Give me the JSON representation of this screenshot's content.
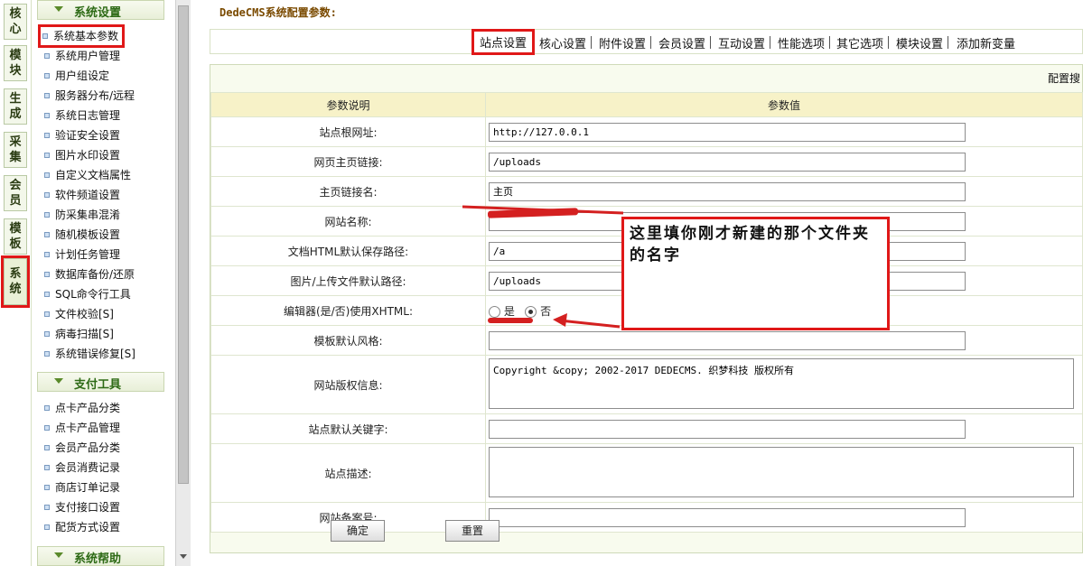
{
  "vtabs": [
    {
      "label": "核心"
    },
    {
      "label": "模块"
    },
    {
      "label": "生成"
    },
    {
      "label": "采集"
    },
    {
      "label": "会员"
    },
    {
      "label": "模板"
    },
    {
      "label": "系统"
    }
  ],
  "menu": {
    "sections": [
      {
        "title": "系统设置",
        "items": [
          "系统基本参数",
          "系统用户管理",
          "用户组设定",
          "服务器分布/远程",
          "系统日志管理",
          "验证安全设置",
          "图片水印设置",
          "自定义文档属性",
          "软件频道设置",
          "防采集串混淆",
          "随机模板设置",
          "计划任务管理",
          "数据库备份/还原",
          "SQL命令行工具",
          "文件校验[S]",
          "病毒扫描[S]",
          "系统错误修复[S]"
        ]
      },
      {
        "title": "支付工具",
        "items": [
          "点卡产品分类",
          "点卡产品管理",
          "会员产品分类",
          "会员消费记录",
          "商店订单记录",
          "支付接口设置",
          "配货方式设置"
        ]
      },
      {
        "title": "系统帮助",
        "items": []
      }
    ]
  },
  "main": {
    "title": "DedeCMS系统配置参数:",
    "tabs": [
      "站点设置",
      "核心设置",
      "附件设置",
      "会员设置",
      "互动设置",
      "性能选项",
      "其它选项",
      "模块设置",
      "添加新变量"
    ],
    "search_label": "配置搜",
    "col_desc": "参数说明",
    "col_val": "参数值",
    "rows": [
      {
        "label": "站点根网址:",
        "value": "http://127.0.0.1"
      },
      {
        "label": "网页主页链接:",
        "value": "/uploads"
      },
      {
        "label": "主页链接名:",
        "value": "主页"
      },
      {
        "label": "网站名称:",
        "value": ""
      },
      {
        "label": "文档HTML默认保存路径:",
        "value": "/a"
      },
      {
        "label": "图片/上传文件默认路径:",
        "value": "/uploads"
      },
      {
        "label": "编辑器(是/否)使用XHTML:",
        "yes": "是",
        "no": "否"
      },
      {
        "label": "模板默认风格:",
        "value": ""
      },
      {
        "label": "网站版权信息:",
        "value": "Copyright &copy; 2002-2017 DEDECMS. 织梦科技 版权所有"
      },
      {
        "label": "站点默认关键字:",
        "value": ""
      },
      {
        "label": "站点描述:",
        "value": ""
      },
      {
        "label": "网站备案号:",
        "value": ""
      }
    ],
    "ok_button": "确定",
    "reset_button": "重置"
  },
  "annotation": {
    "text": "这里填你刚才新建的那个文件夹的名字"
  },
  "colors": {
    "highlight": "#e01818",
    "header_bg": "#f7f2c8",
    "menu_green": "#2d6a15"
  }
}
